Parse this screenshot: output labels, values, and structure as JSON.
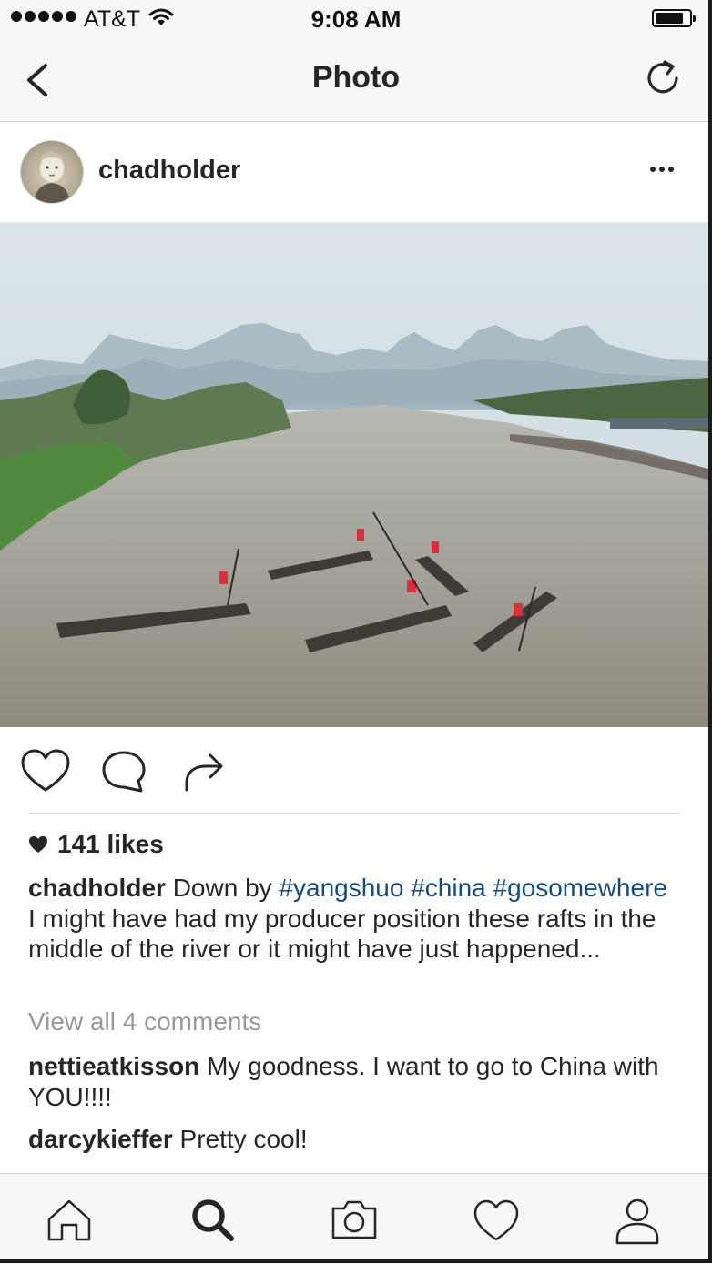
{
  "status_bar": {
    "carrier": "AT&T",
    "time": "9:08 AM",
    "icons": [
      "signal-dots-icon",
      "wifi-icon",
      "battery-icon"
    ]
  },
  "nav": {
    "title": "Photo",
    "back_icon": "chevron-left-icon",
    "refresh_icon": "refresh-icon"
  },
  "post": {
    "username": "chadholder",
    "more_icon": "ellipsis-icon",
    "photo_icon": "river-landscape-photo",
    "actions": [
      "heart-icon",
      "comment-icon",
      "share-icon"
    ],
    "likes": "141 likes",
    "caption": {
      "user": "chadholder",
      "text_1": "Down by",
      "tag_1": "#yangshuo",
      "tag_2": "#china",
      "tag_3": "#gosomewhere",
      "text_2": "I might have had my producer position these rafts in the middle of the river or it might have just happened..."
    },
    "view_all_comments": "View all 4 comments",
    "comments": [
      {
        "user": "nettieatkisson",
        "text": "My goodness.  I want to go to China with YOU!!!!"
      },
      {
        "user": "darcykieffer",
        "text": "Pretty cool!"
      }
    ]
  },
  "tab_bar": {
    "tabs": [
      "home-icon",
      "search-icon",
      "camera-icon",
      "heart-icon",
      "profile-icon"
    ],
    "active": "search-icon"
  },
  "colors": {
    "hashtag": "#1a4a7a",
    "muted_text": "#999999",
    "bar_background": "#f7f7f7",
    "text": "#262626"
  }
}
